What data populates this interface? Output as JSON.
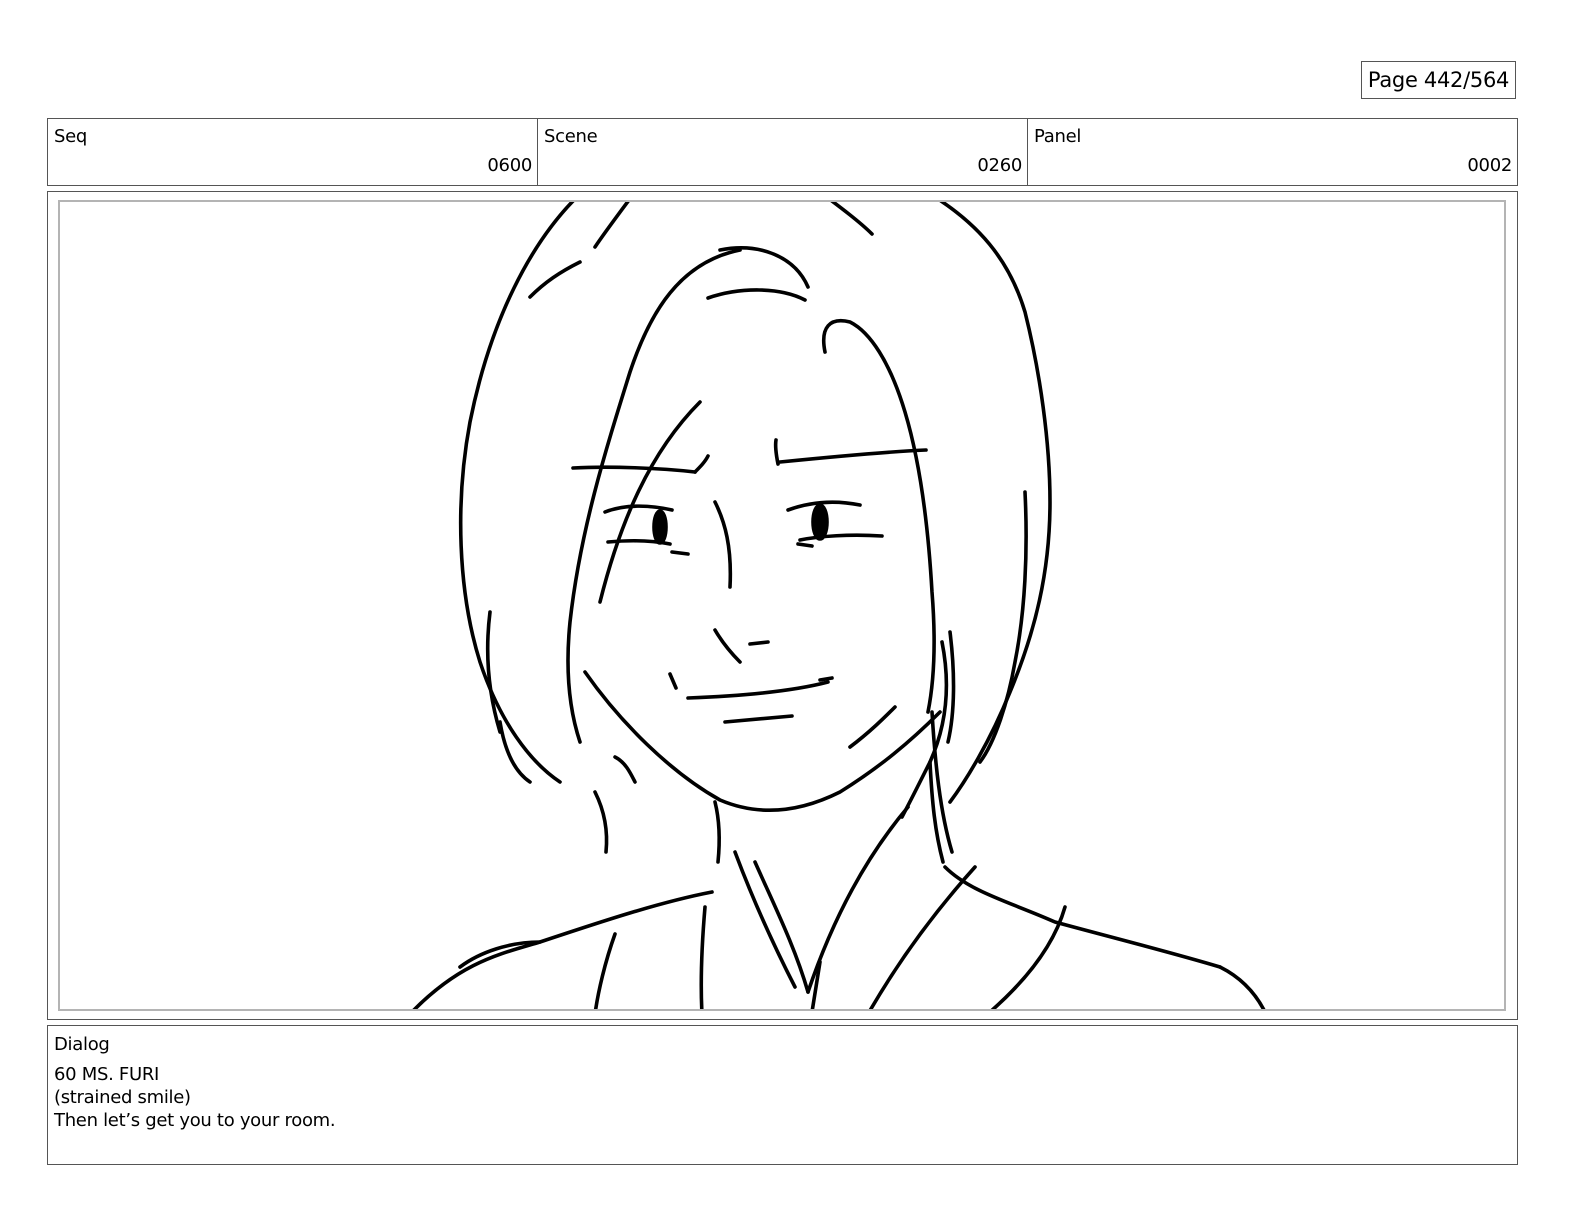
{
  "page": {
    "label": "Page 442/564"
  },
  "info": {
    "seq": {
      "label": "Seq",
      "value": "0600"
    },
    "scene": {
      "label": "Scene",
      "value": "0260"
    },
    "panel": {
      "label": "Panel",
      "value": "0002"
    }
  },
  "dialog": {
    "label": "Dialog",
    "lines": [
      "60 MS. FURI",
      "(strained smile)",
      "Then let’s get you to your room."
    ]
  },
  "sketch": {
    "icon": "character-sketch",
    "stroke_color": "#000000",
    "frame_color": "#b4b4b4"
  }
}
